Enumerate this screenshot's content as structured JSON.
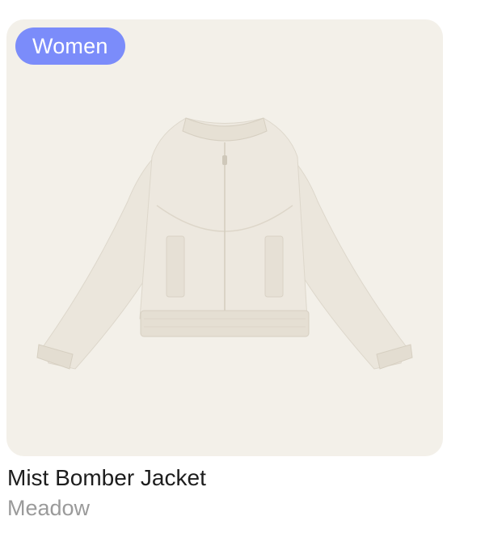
{
  "product": {
    "badge": "Women",
    "name": "Mist Bomber Jacket",
    "brand": "Meadow",
    "image_icon": "bomber-jacket-image"
  },
  "colors": {
    "card_background": "#f3f0e9",
    "badge_background": "#7b8cfa",
    "badge_text": "#ffffff",
    "name_text": "#1d1d1d",
    "brand_text": "#9a9a9a",
    "jacket": "#ebe6dc"
  }
}
